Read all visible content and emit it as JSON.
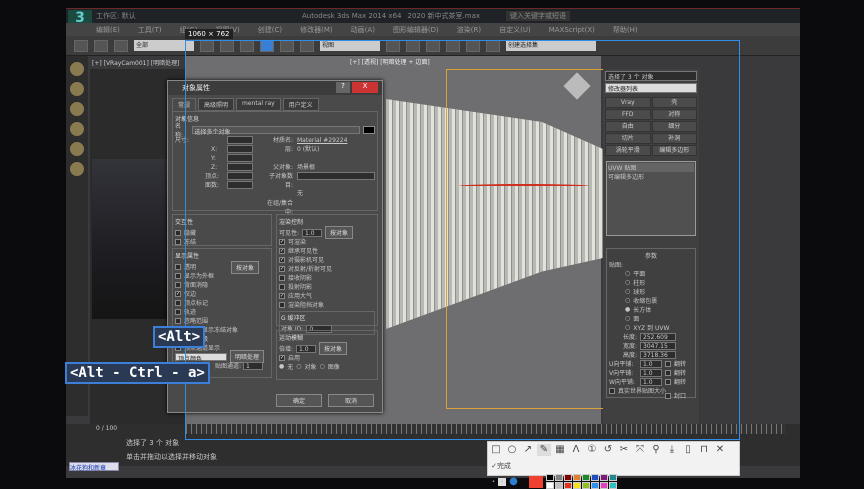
{
  "window": {
    "title": "Autodesk 3ds Max 2014 x64",
    "file": "2020 新中式茶室.max",
    "workspace": "工作区: 默认",
    "search_placeholder": "键入关键字或短语"
  },
  "menu": [
    "编辑(E)",
    "工具(T)",
    "组(G)",
    "视图(V)",
    "创建(C)",
    "修改器(M)",
    "动画(A)",
    "图形编辑器(D)",
    "渲染(R)",
    "自定义(U)",
    "MAXScript(X)",
    "帮助(H)"
  ],
  "toolbar": {
    "filter": "全部",
    "ref_coord": "视图",
    "selection_set": "创建选择集"
  },
  "capture_size": "1060 × 762",
  "viewports": {
    "left_label": "[+] [VRayCam001] [明暗处理]",
    "main_label": "[+] [透视] [明暗处理 + 边面]"
  },
  "dialog": {
    "title": "对象属性",
    "help": "?",
    "close": "X",
    "tabs": [
      "常规",
      "高级照明",
      "mental ray",
      "用户定义"
    ],
    "info_title": "对象信息",
    "name_label": "名称:",
    "name_value": "选择多个对象",
    "dims_label": "尺寸:",
    "x": "X:",
    "y": "Y:",
    "z": "Z:",
    "verts": "顶点:",
    "faces": "面数:",
    "material_label": "材质名:",
    "material_value": "Material #29224",
    "layer_label": "层:",
    "layer_value": "0 (默认)",
    "parent_label": "父对象:",
    "parent_value": "场景根",
    "children_label": "子对象数目:",
    "group_label": "在组/集合中:",
    "group_value": "无",
    "interactivity_title": "交互性",
    "hide": "隐藏",
    "freeze": "冻结",
    "display_title": "显示属性",
    "by_object": "按对象",
    "display_items": [
      {
        "label": "透明",
        "checked": false
      },
      {
        "label": "显示为外框",
        "checked": false
      },
      {
        "label": "背面消隐",
        "checked": false
      },
      {
        "label": "仅边",
        "checked": true
      },
      {
        "label": "顶点标记",
        "checked": false
      },
      {
        "label": "轨迹",
        "checked": false
      },
      {
        "label": "忽略范围",
        "checked": false
      },
      {
        "label": "以灰色显示冻结对象",
        "checked": false
      },
      {
        "label": "永不降级",
        "checked": false
      },
      {
        "label": "顶点通道显示",
        "checked": false
      }
    ],
    "vertex_channel": "顶点颜色",
    "map_channel_btn": "明暗处理",
    "map_channel_label": "贴图通道:",
    "map_channel_value": "1",
    "render_title": "渲染控制",
    "visibility_label": "可见性:",
    "visibility_value": "1.0",
    "by_object2": "按对象",
    "render_items": [
      {
        "label": "可渲染",
        "checked": true
      },
      {
        "label": "继承可见性",
        "checked": true
      },
      {
        "label": "对摄影机可见",
        "checked": true
      },
      {
        "label": "对反射/折射可见",
        "checked": true
      },
      {
        "label": "接收阴影",
        "checked": false
      },
      {
        "label": "投射阴影",
        "checked": false
      },
      {
        "label": "应用大气",
        "checked": true
      },
      {
        "label": "渲染阻挡对象",
        "checked": false
      }
    ],
    "gbuffer_title": "G 缓冲区",
    "object_id_label": "对象 ID:",
    "object_id_value": "0",
    "motion_blur_title": "运动模糊",
    "multiplier_label": "倍增:",
    "multiplier_value": "1.0",
    "by_object3": "按对象",
    "enabled": "启用",
    "blur_none": "无",
    "blur_object": "对象",
    "blur_image": "图像",
    "ok": "确定",
    "cancel": "取消"
  },
  "command_panel": {
    "object_name": "选择了 3 个 对象",
    "modifier_list": "修改器列表",
    "buttons": [
      "Vray",
      "壳",
      "FFD",
      "对称",
      "自由",
      "细分",
      "切片",
      "补洞",
      "涡轮平滑",
      "编辑多边形"
    ],
    "stack": [
      "UVW 贴图",
      "可编辑多边形"
    ],
    "params_title": "参数",
    "mapping_label": "贴图:",
    "mapping": [
      {
        "label": "平面",
        "on": false
      },
      {
        "label": "柱形",
        "on": false
      },
      {
        "label": "球形",
        "on": false
      },
      {
        "label": "收缩包裹",
        "on": false
      },
      {
        "label": "长方体",
        "on": true
      },
      {
        "label": "面",
        "on": false
      },
      {
        "label": "XYZ 到 UVW",
        "on": false
      }
    ],
    "cap": "封口",
    "length_label": "长度:",
    "length": "252.609",
    "width_label": "宽度:",
    "width": "3047.15",
    "height_label": "高度:",
    "height": "3718.36",
    "u_tile_label": "U向平铺:",
    "u_tile": "1.0",
    "v_tile_label": "V向平铺:",
    "v_tile": "1.0",
    "w_tile_label": "W向平铺:",
    "w_tile": "1.0",
    "flip": "翻转",
    "real_world": "真实世界贴图大小"
  },
  "status": {
    "selected": "选择了 3 个 对象",
    "hint": "单击并拖动以选择并移动对象",
    "frame": "0 / 100",
    "task": "冰花狗和新章"
  },
  "keys": [
    "<Alt>",
    "<Alt - Ctrl - a>"
  ],
  "capture_toolbar": {
    "done": "完成",
    "tools": [
      "rect",
      "circle",
      "arrow",
      "pen",
      "mosaic",
      "text",
      "number",
      "undo",
      "cut",
      "copy",
      "pin",
      "save",
      "phone",
      "bookmark",
      "cancel",
      "done"
    ],
    "colors": [
      "#000000",
      "#808080",
      "#800000",
      "#e08030",
      "#1d8a2a",
      "#2050c0",
      "#801880",
      "#208a90",
      "#ffffff",
      "#c0c0c0",
      "#e83020",
      "#f8e020",
      "#90c020",
      "#3090f0",
      "#e040c0",
      "#30c0c0"
    ],
    "current_color": "#f04030"
  }
}
